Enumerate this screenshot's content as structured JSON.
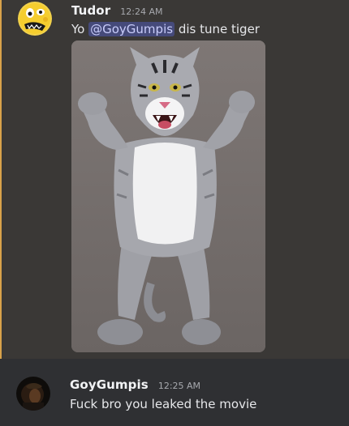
{
  "messages": [
    {
      "author": "Tudor",
      "timestamp": "12:24 AM",
      "text_before": "Yo ",
      "mention": "@GoyGumpis",
      "text_after": " dis tune tiger",
      "attachment_icon": "tiger-mascot-image"
    },
    {
      "author": "GoyGumpis",
      "timestamp": "12:25 AM",
      "text": "Fuck bro you leaked the movie"
    }
  ],
  "colors": {
    "background": "#3a3836",
    "hover_background": "#2f3033",
    "author_text": "#f2f3f5",
    "mention_bg": "#454a7a",
    "mention_text": "#c9cdfb",
    "highlight_bar": "#d8a24a"
  }
}
